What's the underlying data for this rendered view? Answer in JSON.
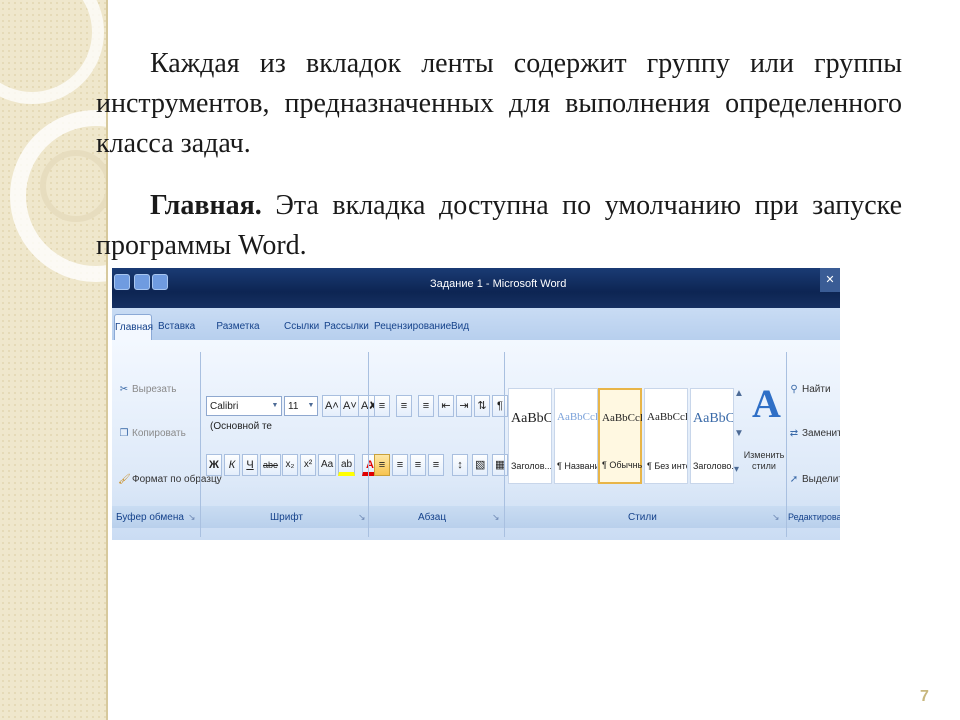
{
  "slide": {
    "paragraph1": "Каждая из вкладок ленты содержит группу или группы инструментов, предназначенных для выполнения определенного класса задач.",
    "paragraph2_bold": "Главная.",
    "paragraph2_rest": " Эта вкладка доступна по умолчанию при запуске программы  Word.",
    "page_number": "7"
  },
  "window": {
    "title": "Задание 1 - Microsoft Word",
    "close_glyph": "✕"
  },
  "tabs": [
    "Главная",
    "Вставка",
    "Разметка страницы",
    "Ссылки",
    "Рассылки",
    "Рецензирование",
    "Вид"
  ],
  "clipboard": {
    "cut": "Вырезать",
    "copy": "Копировать",
    "format_painter": "Формат по образцу",
    "label": "Буфер обмена"
  },
  "font": {
    "font_name": "Calibri (Основной те",
    "font_size": "11",
    "grow": "A˄",
    "shrink": "A˅",
    "clear": "A✘",
    "bold": "Ж",
    "italic": "К",
    "underline": "Ч",
    "strike": "abe",
    "subscript": "x₂",
    "superscript": "x²",
    "change_case": "Aa",
    "highlight": "ab",
    "font_color": "A",
    "label": "Шрифт"
  },
  "paragraph": {
    "bullets": "≡",
    "numbering": "≡",
    "multilevel": "≡",
    "decrease_indent": "⇤",
    "increase_indent": "⇥",
    "sort": "⇅",
    "pilcrow": "¶",
    "align_left": "≡",
    "align_center": "≡",
    "align_right": "≡",
    "justify": "≡",
    "line_spacing": "↕",
    "shading": "▧",
    "borders": "▦",
    "label": "Абзац"
  },
  "styles": {
    "items": [
      {
        "sample": "AaBbCc",
        "name": "Заголов..."
      },
      {
        "sample": "AaBbCcDt",
        "name": "¶ Названи..."
      },
      {
        "sample": "AaBbCcDc",
        "name": "¶ Обычный"
      },
      {
        "sample": "AaBbCcDc",
        "name": "¶ Без инте..."
      },
      {
        "sample": "AaBbCc",
        "name": "Заголово..."
      }
    ],
    "change_styles": "Изменить стили",
    "label": "Стили"
  },
  "editing": {
    "find": "Найти",
    "replace": "Заменить",
    "select": "Выделить",
    "label": "Редактирование"
  },
  "colors": {
    "titlebar": "#0d2553",
    "tab_text": "#15428b",
    "highlight_yellow": "#ffff00",
    "font_red": "#e00000"
  }
}
